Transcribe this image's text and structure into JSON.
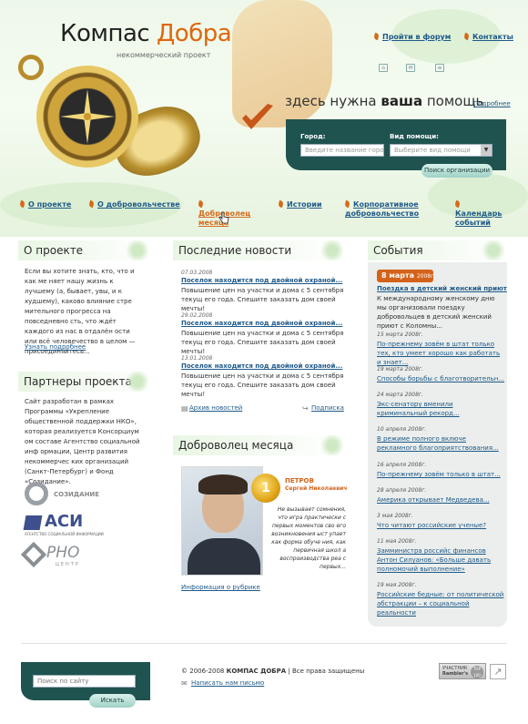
{
  "header": {
    "logo_part1": "Компас",
    "logo_part2": "Добра",
    "tagline": "некоммерческий проект",
    "forum_link": "Пройти в форум",
    "contacts_link": "Контакты",
    "help_prefix": "здесь нужна",
    "help_bold": "ваша",
    "help_suffix": "помощь",
    "help_more": "Подробнее"
  },
  "search": {
    "city_label": "Город:",
    "city_placeholder": "Введите название города",
    "help_type_label": "Вид помощи:",
    "help_type_value": "Выберите вид помощи",
    "button": "Поиск организации"
  },
  "nav": [
    {
      "label": "О проекте"
    },
    {
      "label": "О добровольчестве"
    },
    {
      "label": "Доброволец месяца"
    },
    {
      "label": "Истории"
    },
    {
      "label": "Корпоративное добровольчество"
    },
    {
      "label": "Календарь событий"
    }
  ],
  "about": {
    "title": "О проекте",
    "text": "Если вы хотите знать, кто, что и как ме няет нашу жизнь к лучшему (а, бывает, увы, и к худшему), каково влияние стре мительного прогресса на повседневно сть, что ждёт каждого из нас в отдалён ости или всё человечество в целом — присоединяйтесь...",
    "more": "Узнать подробнее"
  },
  "partners": {
    "title": "Партнеры проекта",
    "text": "Сайт разработан в рамках Программы «Укрепление общественной поддержки НКО», которая реализуется Консорциум ом  составе Агентство социальной инф ормации, Центр развития некоммерчес ких организаций (Санкт-Петербург) и Фонд «Созидание».",
    "logo1": "СОЗИДАНИЕ",
    "logo2": "АСИ",
    "logo2_sub": "АГЕНТСТВО СОЦИАЛЬНОЙ ИНФОРМАЦИИ",
    "logo3": "РНО",
    "logo3_sub": "ЦЕНТР"
  },
  "news": {
    "title": "Последние новости",
    "items": [
      {
        "date": "07.03.2008",
        "title": "Поселок находится под двойной охраной...",
        "text": "Повышение цен на участки и дома с 5 сентября текущ его года. Спешите заказать дом своей мечты!"
      },
      {
        "date": "29.02.2008",
        "title": "Поселок находится под двойной охраной...",
        "text": "Повышение цен на участки и дома с 5 сентября текущ его года. Спешите заказать дом своей мечты!"
      },
      {
        "date": "13.01.2008",
        "title": "Поселок находится под двойной охраной...",
        "text": "Повышение цен на участки и дома с 5 сентября текущ его года. Спешите заказать дом своей мечты!"
      }
    ],
    "archive": "Архив новостей",
    "subscribe": "Подписка"
  },
  "volunteer": {
    "title": "Доброволец месяца",
    "surname": "ПЕТРОВ",
    "name": "Сергей Николаевич",
    "quote": "Не вызывает сомнения, что игра практически с первых моментов сво его возникновения ыст упает как форма обуче ния, как первичная школ а воспроизводства реа с первых...",
    "rubric_link": "Информация о рубрике",
    "medal": "1"
  },
  "events": {
    "title": "События",
    "first_day": "8 марта",
    "first_year": "2008г.",
    "first_title": "Поездка в детский женский приют",
    "first_text": "К международному женскому дню  мы организовали поездку добровольцев в детский женский приют с Коломны...",
    "items": [
      {
        "date": "15 марта 2008г.",
        "text": "По-прежнему зовём в штат только тех, кто умеет хорошо как работать и знает..."
      },
      {
        "date": "19 марта 2008г.",
        "text": "Способы борьбы с благотворительн..."
      },
      {
        "date": "24 марта 2008г.",
        "text": "Экс-сенатору  вменили  криминальный рекорд..."
      },
      {
        "date": "10 апреля 2008г.",
        "text": "В режиме полного включе рекламного благоприятствования..."
      },
      {
        "date": "16 апреля 2008г.",
        "text": "По-прежнему зовём только в штат..."
      },
      {
        "date": "28 апреля 2008г.",
        "text": "Америка открывает Медведева..."
      },
      {
        "date": "3 мая 2008г.",
        "text": "Что читают российские ученые?"
      },
      {
        "date": "11 мая 2008г.",
        "text": "Замминистра российс финансов Антон Силуанов: «Больше давать полномочий выполнение»"
      },
      {
        "date": "19 мая 2008г.",
        "text": "Российские бедные: от политической абстракции – к социальной реальности"
      }
    ]
  },
  "footer": {
    "search_placeholder": "Поиск по сайту",
    "search_button": "Искать",
    "copyright_years": "2006-2008",
    "copyright_name": "КОМПАС ДОБРА",
    "copyright_rights": "Все права защищены",
    "mail_link": "Написать нам письмо",
    "badge_text": "УЧАСТНИК",
    "badge_sub": "Rambler's",
    "badge_top": "TOP 100"
  },
  "colors": {
    "accent": "#d4621a",
    "dark_teal": "#1f5350",
    "link": "#1f5a8a"
  }
}
